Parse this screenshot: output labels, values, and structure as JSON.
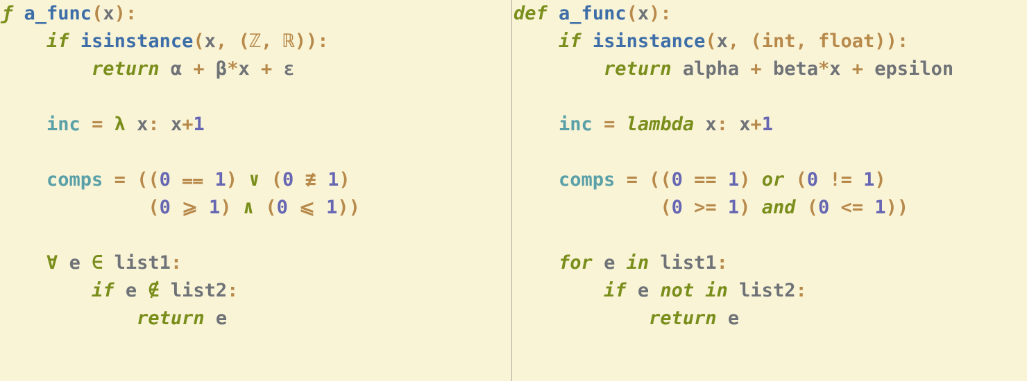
{
  "left": {
    "l1": {
      "def": "ƒ",
      "sp1": " ",
      "fn": "a_func",
      "po": "(",
      "arg": "x",
      "pc": ")",
      "colon": ":"
    },
    "l2": {
      "pad": "    ",
      "if": "if",
      "sp1": " ",
      "isin": "isinstance",
      "po": "(",
      "x": "x",
      "c1": ",",
      "sp2": " ",
      "po2": "(",
      "ty1": "ℤ",
      "c2": ",",
      "sp3": " ",
      "ty2": "ℝ",
      "pc2": ")",
      "pc": ")",
      "colon": ":"
    },
    "l3": {
      "pad": "        ",
      "ret": "return",
      "sp1": " ",
      "a": "α",
      "sp2": " ",
      "plus1": "+",
      "sp3": " ",
      "b": "β",
      "star": "*",
      "x": "x",
      "sp4": " ",
      "plus2": "+",
      "sp5": " ",
      "e": "ε"
    },
    "l5": {
      "pad": "    ",
      "inc": "inc",
      "sp1": " ",
      "eq": "=",
      "sp2": " ",
      "lam": "λ",
      "sp3": " ",
      "x": "x",
      "colon": ":",
      "sp4": " ",
      "x2": "x",
      "plus": "+",
      "one": "1"
    },
    "l7": {
      "pad": "    ",
      "comps": "comps",
      "sp1": " ",
      "eq": "=",
      "sp2": " ",
      "po1": "(",
      "po2": "(",
      "z1": "0",
      "sp3": " ",
      "op_eq": "⩵",
      "sp4": " ",
      "o1": "1",
      "pc2": ")",
      "sp5": " ",
      "or": "∨",
      "sp6": " ",
      "po3": "(",
      "z2": "0",
      "sp7": " ",
      "op_ne": "≢",
      "sp8": " ",
      "o2": "1",
      "pc3": ")"
    },
    "l8": {
      "pad": "             ",
      "po": "(",
      "z1": "0",
      "sp1": " ",
      "op_ge": "⩾",
      "sp2": " ",
      "o1": "1",
      "pc": ")",
      "sp3": " ",
      "and": "∧",
      "sp4": " ",
      "po2": "(",
      "z2": "0",
      "sp5": " ",
      "op_le": "⩽",
      "sp6": " ",
      "o2": "1",
      "pc2": ")",
      "pc3": ")"
    },
    "l10": {
      "pad": "    ",
      "for": "∀",
      "sp1": " ",
      "e": "e",
      "sp2": " ",
      "in": "∈",
      "sp3": " ",
      "lst": "list1",
      "colon": ":"
    },
    "l11": {
      "pad": "        ",
      "if": "if",
      "sp1": " ",
      "e": "e",
      "sp2": " ",
      "nin": "∉",
      "sp3": " ",
      "lst": "list2",
      "colon": ":"
    },
    "l12": {
      "pad": "            ",
      "ret": "return",
      "sp1": " ",
      "e": "e"
    }
  },
  "right": {
    "l1": {
      "def": "def",
      "sp1": " ",
      "fn": "a_func",
      "po": "(",
      "arg": "x",
      "pc": ")",
      "colon": ":"
    },
    "l2": {
      "pad": "    ",
      "if": "if",
      "sp1": " ",
      "isin": "isinstance",
      "po": "(",
      "x": "x",
      "c1": ",",
      "sp2": " ",
      "po2": "(",
      "ty1": "int",
      "c2": ",",
      "sp3": " ",
      "ty2": "float",
      "pc2": ")",
      "pc": ")",
      "colon": ":"
    },
    "l3": {
      "pad": "        ",
      "ret": "return",
      "sp1": " ",
      "a": "alpha",
      "sp2": " ",
      "plus1": "+",
      "sp3": " ",
      "b": "beta",
      "star": "*",
      "x": "x",
      "sp4": " ",
      "plus2": "+",
      "sp5": " ",
      "e": "epsilon"
    },
    "l5": {
      "pad": "    ",
      "inc": "inc",
      "sp1": " ",
      "eq": "=",
      "sp2": " ",
      "lam": "lambda",
      "sp3": " ",
      "x": "x",
      "colon": ":",
      "sp4": " ",
      "x2": "x",
      "plus": "+",
      "one": "1"
    },
    "l7": {
      "pad": "    ",
      "comps": "comps",
      "sp1": " ",
      "eq": "=",
      "sp2": " ",
      "po1": "(",
      "po2": "(",
      "z1": "0",
      "sp3": " ",
      "op_eq": "==",
      "sp4": " ",
      "o1": "1",
      "pc2": ")",
      "sp5": " ",
      "or": "or",
      "sp6": " ",
      "po3": "(",
      "z2": "0",
      "sp7": " ",
      "op_ne": "!=",
      "sp8": " ",
      "o2": "1",
      "pc3": ")"
    },
    "l8": {
      "pad": "             ",
      "po": "(",
      "z1": "0",
      "sp1": " ",
      "op_ge": ">=",
      "sp2": " ",
      "o1": "1",
      "pc": ")",
      "sp3": " ",
      "and": "and",
      "sp4": " ",
      "po2": "(",
      "z2": "0",
      "sp5": " ",
      "op_le": "<=",
      "sp6": " ",
      "o2": "1",
      "pc2": ")",
      "pc3": ")"
    },
    "l10": {
      "pad": "    ",
      "for": "for",
      "sp1": " ",
      "e": "e",
      "sp2": " ",
      "in": "in",
      "sp3": " ",
      "lst": "list1",
      "colon": ":"
    },
    "l11": {
      "pad": "        ",
      "if": "if",
      "sp1": " ",
      "e": "e",
      "sp2": " ",
      "nin": "not in",
      "sp3": " ",
      "lst": "list2",
      "colon": ":"
    },
    "l12": {
      "pad": "            ",
      "ret": "return",
      "sp1": " ",
      "e": "e"
    }
  }
}
